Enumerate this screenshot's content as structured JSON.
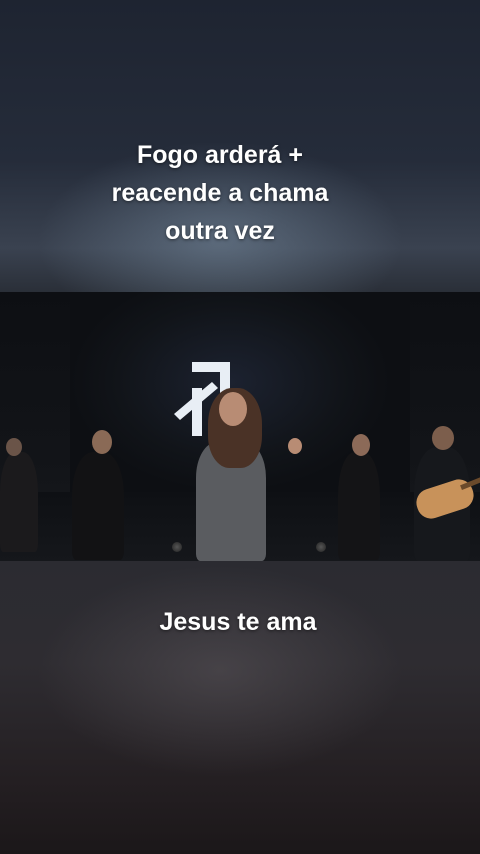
{
  "captions": {
    "top": "Fogo arderá +\nreacende a chama\noutra vez",
    "bottom": "Jesus te ama"
  },
  "colors": {
    "caption_text": "#ffffff",
    "stage_dark": "#0d0f13",
    "logo": "#e8eef5"
  },
  "icons": {
    "stage_logo": "arrow-logo-icon"
  }
}
